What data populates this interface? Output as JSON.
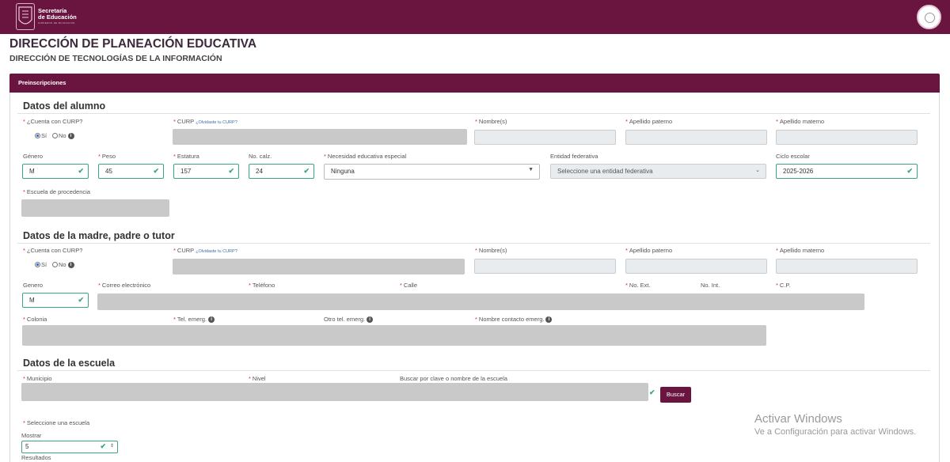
{
  "header": {
    "brand_line1": "Secretaría",
    "brand_line2": "de Educación",
    "brand_line3": "GOBIERNO DE MICHOACÁN"
  },
  "page": {
    "title": "DIRECCIÓN DE PLANEACIÓN EDUCATIVA",
    "subtitle": "DIRECCIÓN DE TECNOLOGÍAS DE LA INFORMACIÓN",
    "card_title": "Preinscripciones"
  },
  "alumno": {
    "section_title": "Datos del alumno",
    "curp_q_label": "¿Cuenta con CURP?",
    "si": "Sí",
    "no": "No",
    "curp_label": "CURP",
    "olvidaste": "¿Olvidaste tu CURP?",
    "nombre_label": "Nombre(s)",
    "apellido_paterno_label": "Apellido paterno",
    "apellido_materno_label": "Apellido materno",
    "genero_label": "Género",
    "genero": "M",
    "peso_label": "Peso",
    "peso": "45",
    "estatura_label": "Estatura",
    "estatura": "157",
    "calzado_label": "No. calz.",
    "calzado": "24",
    "necesidad_label": "Necesidad educativa especial",
    "necesidad": "Ninguna",
    "entidad_label": "Entidad federativa",
    "entidad": "Seleccione una entidad federativa",
    "ciclo_label": "Ciclo escolar",
    "ciclo": "2025-2026",
    "escuela_proc_label": "Escuela de procedencia"
  },
  "tutor": {
    "section_title": "Datos de la madre, padre o tutor",
    "curp_q_label": "¿Cuenta con CURP?",
    "si": "Sí",
    "no": "No",
    "curp_label": "CURP",
    "olvidaste": "¿Olvidaste tu CURP?",
    "nombre_label": "Nombre(s)",
    "apellido_paterno_label": "Apellido paterno",
    "apellido_materno_label": "Apellido materno",
    "genero_label": "Genero",
    "genero": "M",
    "correo_label": "Correo electrónico",
    "telefono_label": "Teléfono",
    "calle_label": "Calle",
    "no_ext_label": "No. Ext.",
    "no_int_label": "No. Int.",
    "cp_label": "C.P.",
    "colonia_label": "Colonia",
    "tel_emerg_label": "Tel. emerg.",
    "otro_tel_label": "Otro tel. emerg.",
    "nombre_contacto_label": "Nombre contacto emerg."
  },
  "escuela": {
    "section_title": "Datos de la escuela",
    "municipio_label": "Municipio",
    "nivel_label": "Nivel",
    "buscar_label": "Buscar por clave o nombre de la escuela",
    "buscar_button": "Buscar",
    "seleccione_label": "Seleccione una escuela",
    "mostrar_label": "Mostrar",
    "mostrar": "5",
    "resultados_label": "Resultados"
  },
  "watermark": {
    "line1": "Activar Windows",
    "line2": "Ve a Configuración para activar Windows."
  },
  "colors": {
    "brand": "#6a1540",
    "valid": "#3aa582",
    "required": "#c0392b"
  }
}
